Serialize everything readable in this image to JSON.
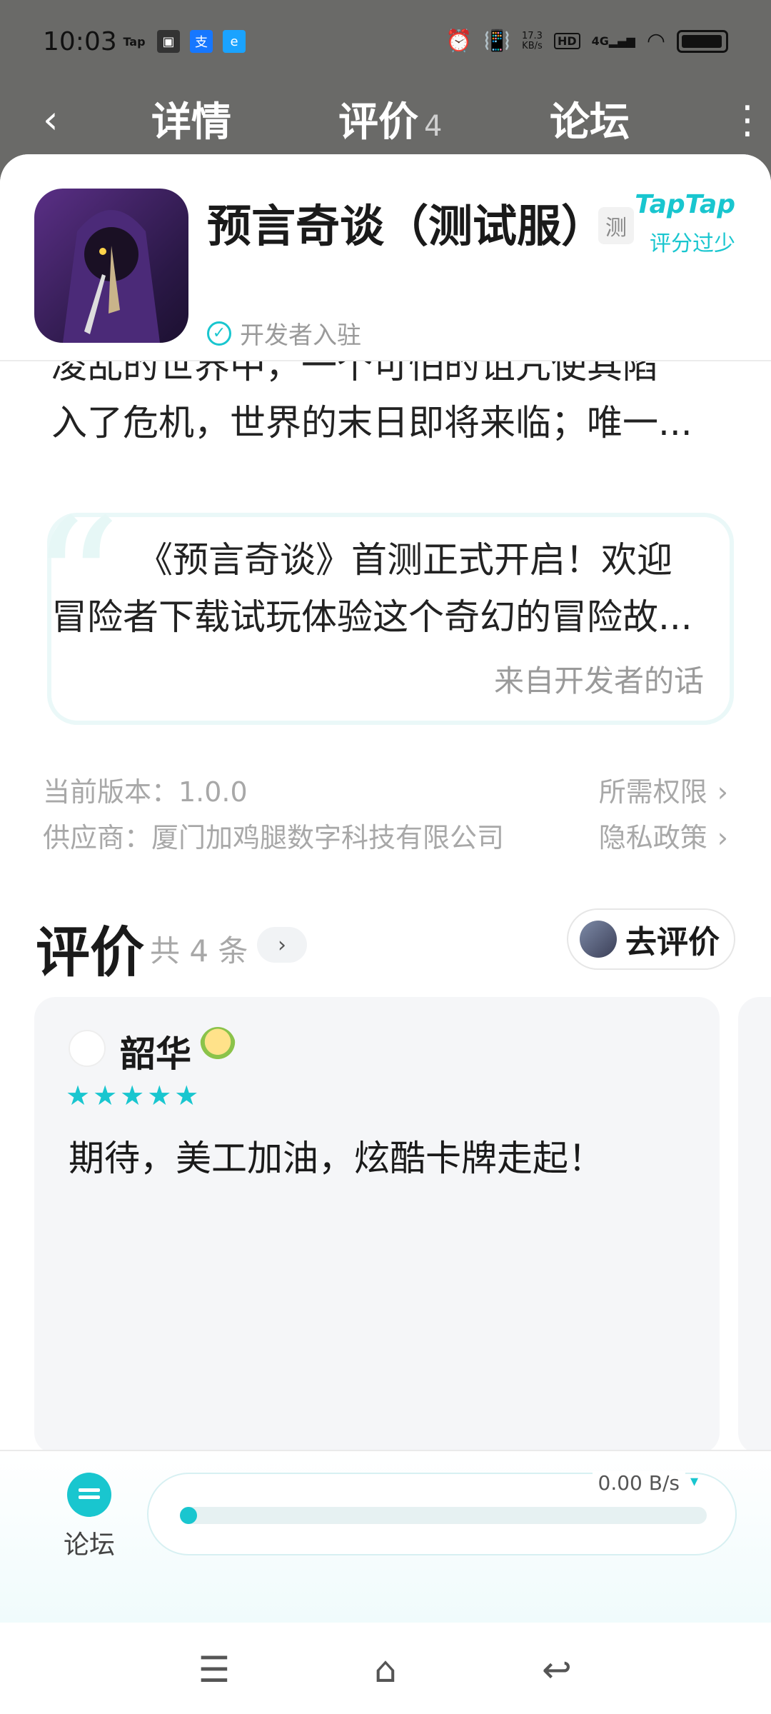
{
  "status_bar": {
    "time": "10:03",
    "left_icons": [
      "tap-icon",
      "wallet-icon",
      "alipay-icon",
      "browser-icon"
    ],
    "tap_text": "Tap",
    "speed_value": "17.3",
    "speed_unit": "KB/s",
    "hd": "HD",
    "network": "4G"
  },
  "nav": {
    "tabs": [
      {
        "label": "详情"
      },
      {
        "label": "评价",
        "count": "4"
      },
      {
        "label": "论坛"
      }
    ]
  },
  "app": {
    "title": "预言奇谈（测试服）",
    "tag": "测",
    "brand": "TapTap",
    "score_note": "评分过少",
    "dev_badge": "开发者入驻"
  },
  "description": {
    "line1": "凌乱的世界中，一个可怕的诅咒使其陷",
    "line2": "入了危机，世界的末日即将来临；唯一..."
  },
  "dev_quote": {
    "line1": "《预言奇谈》首测正式开启！欢迎",
    "line2": "冒险者下载试玩体验这个奇幻的冒险故...",
    "from": "来自开发者的话"
  },
  "meta": {
    "version": "当前版本：1.0.0",
    "vendor": "供应商：厦门加鸡腿数字科技有限公司",
    "permissions": "所需权限",
    "privacy": "隐私政策"
  },
  "reviews": {
    "title": "评价",
    "count": "共 4 条",
    "go_review": "去评价",
    "items": [
      {
        "name": "韶华",
        "stars": "★★★★★",
        "rating": 5,
        "text": "期待，美工加油，炫酷卡牌走起！"
      }
    ]
  },
  "bottom": {
    "forum": "论坛",
    "speed": "0.00 B/s",
    "progress": 0
  },
  "colors": {
    "accent": "#19c6cf",
    "header_bg": "#6a6a68"
  }
}
